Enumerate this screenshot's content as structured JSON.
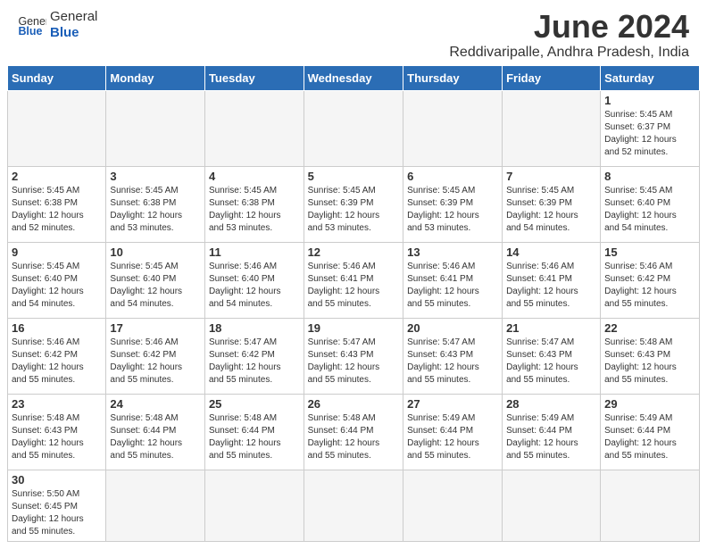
{
  "header": {
    "logo_general": "General",
    "logo_blue": "Blue",
    "title": "June 2024",
    "subtitle": "Reddivaripalle, Andhra Pradesh, India"
  },
  "days_of_week": [
    "Sunday",
    "Monday",
    "Tuesday",
    "Wednesday",
    "Thursday",
    "Friday",
    "Saturday"
  ],
  "weeks": [
    [
      {
        "day": "",
        "info": ""
      },
      {
        "day": "",
        "info": ""
      },
      {
        "day": "",
        "info": ""
      },
      {
        "day": "",
        "info": ""
      },
      {
        "day": "",
        "info": ""
      },
      {
        "day": "",
        "info": ""
      },
      {
        "day": "1",
        "info": "Sunrise: 5:45 AM\nSunset: 6:37 PM\nDaylight: 12 hours\nand 52 minutes."
      }
    ],
    [
      {
        "day": "2",
        "info": "Sunrise: 5:45 AM\nSunset: 6:38 PM\nDaylight: 12 hours\nand 52 minutes."
      },
      {
        "day": "3",
        "info": "Sunrise: 5:45 AM\nSunset: 6:38 PM\nDaylight: 12 hours\nand 53 minutes."
      },
      {
        "day": "4",
        "info": "Sunrise: 5:45 AM\nSunset: 6:38 PM\nDaylight: 12 hours\nand 53 minutes."
      },
      {
        "day": "5",
        "info": "Sunrise: 5:45 AM\nSunset: 6:39 PM\nDaylight: 12 hours\nand 53 minutes."
      },
      {
        "day": "6",
        "info": "Sunrise: 5:45 AM\nSunset: 6:39 PM\nDaylight: 12 hours\nand 53 minutes."
      },
      {
        "day": "7",
        "info": "Sunrise: 5:45 AM\nSunset: 6:39 PM\nDaylight: 12 hours\nand 54 minutes."
      },
      {
        "day": "8",
        "info": "Sunrise: 5:45 AM\nSunset: 6:40 PM\nDaylight: 12 hours\nand 54 minutes."
      }
    ],
    [
      {
        "day": "9",
        "info": "Sunrise: 5:45 AM\nSunset: 6:40 PM\nDaylight: 12 hours\nand 54 minutes."
      },
      {
        "day": "10",
        "info": "Sunrise: 5:45 AM\nSunset: 6:40 PM\nDaylight: 12 hours\nand 54 minutes."
      },
      {
        "day": "11",
        "info": "Sunrise: 5:46 AM\nSunset: 6:40 PM\nDaylight: 12 hours\nand 54 minutes."
      },
      {
        "day": "12",
        "info": "Sunrise: 5:46 AM\nSunset: 6:41 PM\nDaylight: 12 hours\nand 55 minutes."
      },
      {
        "day": "13",
        "info": "Sunrise: 5:46 AM\nSunset: 6:41 PM\nDaylight: 12 hours\nand 55 minutes."
      },
      {
        "day": "14",
        "info": "Sunrise: 5:46 AM\nSunset: 6:41 PM\nDaylight: 12 hours\nand 55 minutes."
      },
      {
        "day": "15",
        "info": "Sunrise: 5:46 AM\nSunset: 6:42 PM\nDaylight: 12 hours\nand 55 minutes."
      }
    ],
    [
      {
        "day": "16",
        "info": "Sunrise: 5:46 AM\nSunset: 6:42 PM\nDaylight: 12 hours\nand 55 minutes."
      },
      {
        "day": "17",
        "info": "Sunrise: 5:46 AM\nSunset: 6:42 PM\nDaylight: 12 hours\nand 55 minutes."
      },
      {
        "day": "18",
        "info": "Sunrise: 5:47 AM\nSunset: 6:42 PM\nDaylight: 12 hours\nand 55 minutes."
      },
      {
        "day": "19",
        "info": "Sunrise: 5:47 AM\nSunset: 6:43 PM\nDaylight: 12 hours\nand 55 minutes."
      },
      {
        "day": "20",
        "info": "Sunrise: 5:47 AM\nSunset: 6:43 PM\nDaylight: 12 hours\nand 55 minutes."
      },
      {
        "day": "21",
        "info": "Sunrise: 5:47 AM\nSunset: 6:43 PM\nDaylight: 12 hours\nand 55 minutes."
      },
      {
        "day": "22",
        "info": "Sunrise: 5:48 AM\nSunset: 6:43 PM\nDaylight: 12 hours\nand 55 minutes."
      }
    ],
    [
      {
        "day": "23",
        "info": "Sunrise: 5:48 AM\nSunset: 6:43 PM\nDaylight: 12 hours\nand 55 minutes."
      },
      {
        "day": "24",
        "info": "Sunrise: 5:48 AM\nSunset: 6:44 PM\nDaylight: 12 hours\nand 55 minutes."
      },
      {
        "day": "25",
        "info": "Sunrise: 5:48 AM\nSunset: 6:44 PM\nDaylight: 12 hours\nand 55 minutes."
      },
      {
        "day": "26",
        "info": "Sunrise: 5:48 AM\nSunset: 6:44 PM\nDaylight: 12 hours\nand 55 minutes."
      },
      {
        "day": "27",
        "info": "Sunrise: 5:49 AM\nSunset: 6:44 PM\nDaylight: 12 hours\nand 55 minutes."
      },
      {
        "day": "28",
        "info": "Sunrise: 5:49 AM\nSunset: 6:44 PM\nDaylight: 12 hours\nand 55 minutes."
      },
      {
        "day": "29",
        "info": "Sunrise: 5:49 AM\nSunset: 6:44 PM\nDaylight: 12 hours\nand 55 minutes."
      }
    ],
    [
      {
        "day": "30",
        "info": "Sunrise: 5:50 AM\nSunset: 6:45 PM\nDaylight: 12 hours\nand 55 minutes."
      },
      {
        "day": "",
        "info": ""
      },
      {
        "day": "",
        "info": ""
      },
      {
        "day": "",
        "info": ""
      },
      {
        "day": "",
        "info": ""
      },
      {
        "day": "",
        "info": ""
      },
      {
        "day": "",
        "info": ""
      }
    ]
  ]
}
